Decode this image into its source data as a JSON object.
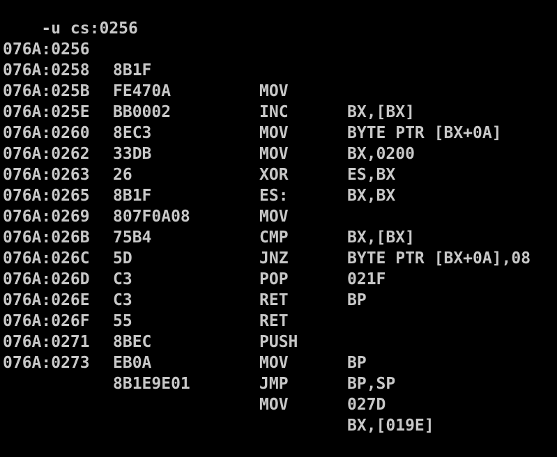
{
  "command": {
    "text": "-u cs:0256"
  },
  "listing": [
    {
      "addr": "076A:0256",
      "bytes": "8B1F",
      "mnemonic": "MOV",
      "operands": "BX,[BX]"
    },
    {
      "addr": "076A:0258",
      "bytes": "FE470A",
      "mnemonic": "INC",
      "operands": "BYTE PTR [BX+0A]"
    },
    {
      "addr": "076A:025B",
      "bytes": "BB0002",
      "mnemonic": "MOV",
      "operands": "BX,0200"
    },
    {
      "addr": "076A:025E",
      "bytes": "8EC3",
      "mnemonic": "MOV",
      "operands": "ES,BX"
    },
    {
      "addr": "076A:0260",
      "bytes": "33DB",
      "mnemonic": "XOR",
      "operands": "BX,BX"
    },
    {
      "addr": "076A:0262",
      "bytes": "26",
      "mnemonic": "ES:",
      "operands": ""
    },
    {
      "addr": "076A:0263",
      "bytes": "8B1F",
      "mnemonic": "MOV",
      "operands": "BX,[BX]"
    },
    {
      "addr": "076A:0265",
      "bytes": "807F0A08",
      "mnemonic": "CMP",
      "operands": "BYTE PTR [BX+0A],08"
    },
    {
      "addr": "076A:0269",
      "bytes": "75B4",
      "mnemonic": "JNZ",
      "operands": "021F"
    },
    {
      "addr": "076A:026B",
      "bytes": "5D",
      "mnemonic": "POP",
      "operands": "BP"
    },
    {
      "addr": "076A:026C",
      "bytes": "C3",
      "mnemonic": "RET",
      "operands": ""
    },
    {
      "addr": "076A:026D",
      "bytes": "C3",
      "mnemonic": "RET",
      "operands": ""
    },
    {
      "addr": "076A:026E",
      "bytes": "55",
      "mnemonic": "PUSH",
      "operands": "BP"
    },
    {
      "addr": "076A:026F",
      "bytes": "8BEC",
      "mnemonic": "MOV",
      "operands": "BP,SP"
    },
    {
      "addr": "076A:0271",
      "bytes": "EB0A",
      "mnemonic": "JMP",
      "operands": "027D"
    },
    {
      "addr": "076A:0273",
      "bytes": "8B1E9E01",
      "mnemonic": "MOV",
      "operands": "BX,[019E]"
    }
  ]
}
